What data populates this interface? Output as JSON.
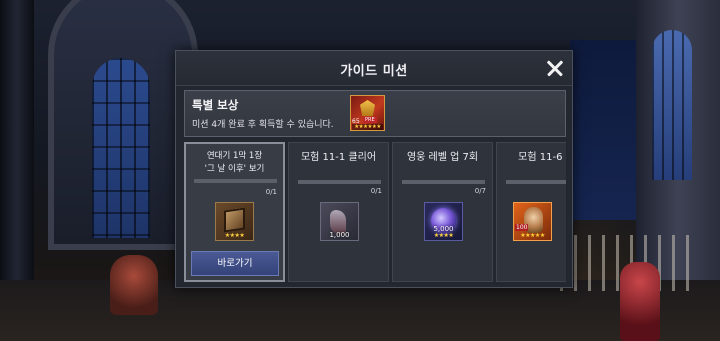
{
  "dialog": {
    "title": "가이드 미션"
  },
  "special_reward": {
    "title": "특별 보상",
    "description": "미션 4개 완료 후 획득할 수 있습니다.",
    "icon": "hero-emblem-icon",
    "level": "65",
    "tag": "PRE",
    "stars": "★★★★★★"
  },
  "missions": [
    {
      "title": "연대기 1막 1장",
      "subtitle": "'그 날 이후' 보기",
      "progress": 0,
      "count": "0/1",
      "item_icon": "treasure-chest-icon",
      "item_stars": "★★★★",
      "button_label": "바로가기"
    },
    {
      "title": "모험 11-1 클리어",
      "progress": 0,
      "count": "0/1",
      "item_icon": "boots-icon",
      "item_qty": "1,000"
    },
    {
      "title": "영웅 레벨 업 7회",
      "progress": 0,
      "count": "0/7",
      "item_icon": "crystal-orb-icon",
      "item_qty": "5,000",
      "item_stars": "★★★★"
    },
    {
      "title": "모험 11-6 클",
      "progress": 0,
      "item_icon": "hero-portrait-icon",
      "item_badge": "100",
      "item_stars": "★★★★★"
    }
  ]
}
